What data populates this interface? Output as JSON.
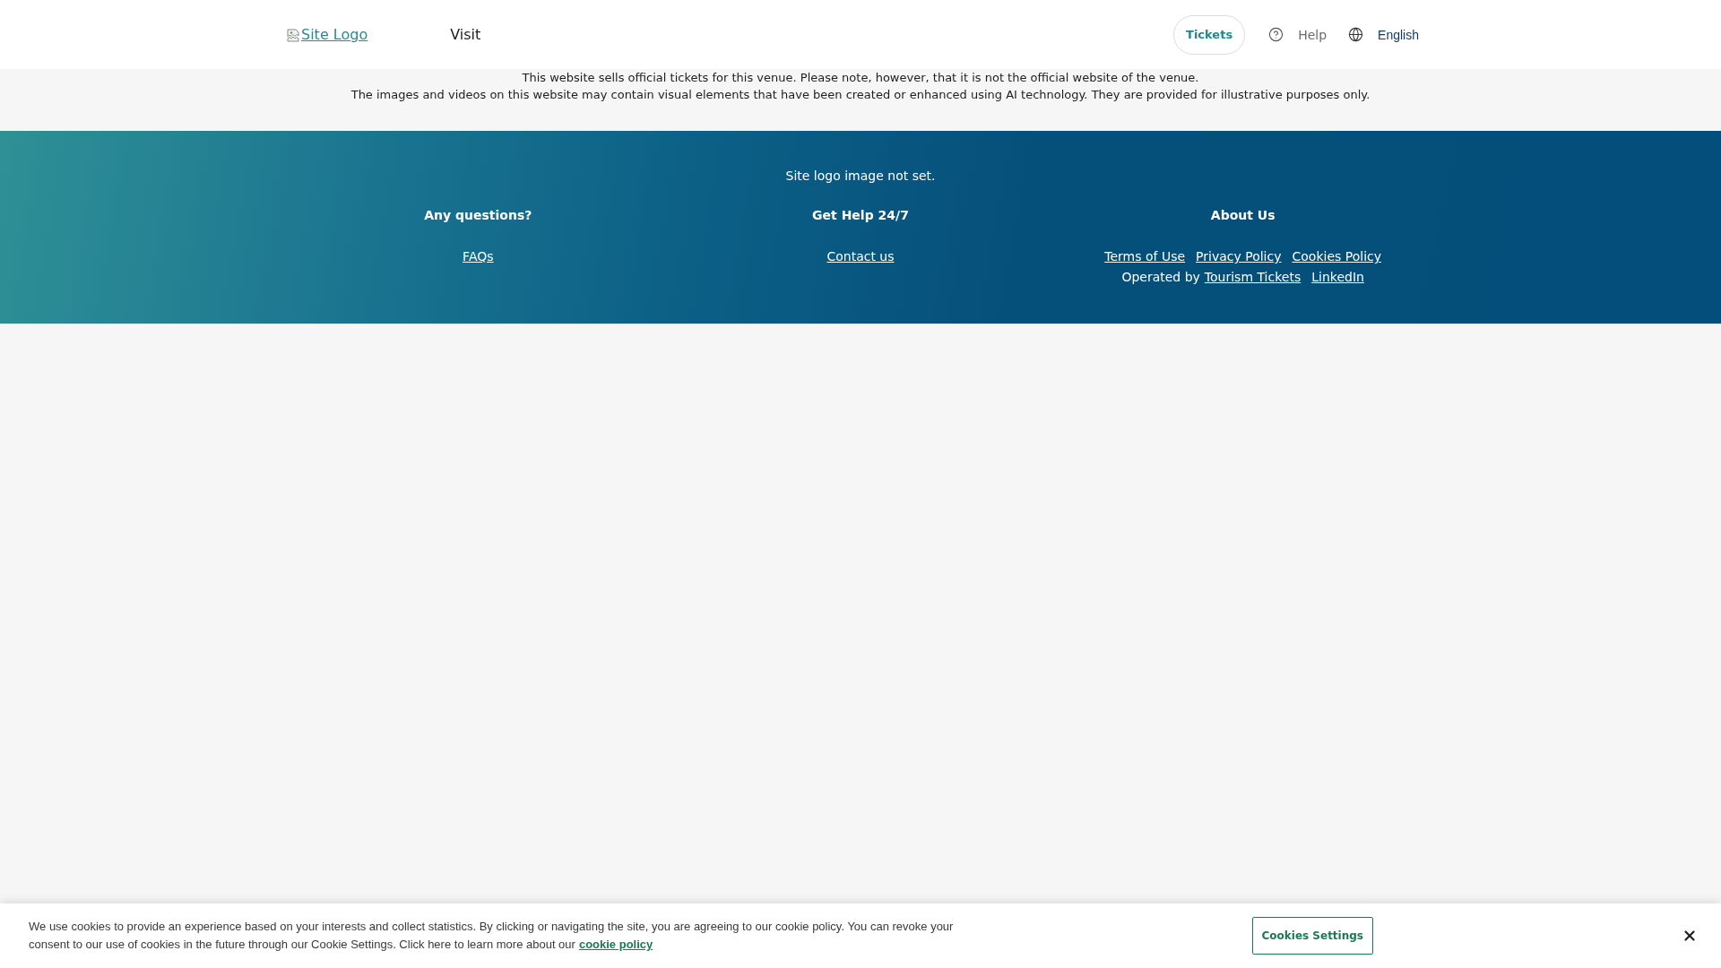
{
  "header": {
    "logo_link": "Site Logo",
    "nav": [
      {
        "label": "Visit"
      }
    ],
    "tickets_button": "Tickets",
    "help_link": "Help",
    "language_button": "English"
  },
  "notice": [
    "This website sells official tickets for this venue. Please note, however, that it is not the official website of the venue.",
    "The images and videos on this website may contain visual elements that have been created or enhanced using AI technology. They are provided for illustrative purposes only."
  ],
  "footer": {
    "logo_message": "Site logo image not set.",
    "columns": [
      {
        "heading": "Any questions?",
        "rows": [
          {
            "items": [
              {
                "kind": "link",
                "text": "FAQs"
              }
            ]
          }
        ]
      },
      {
        "heading": "Get Help 24/7",
        "rows": [
          {
            "items": [
              {
                "kind": "link",
                "text": "Contact us"
              }
            ]
          }
        ]
      },
      {
        "heading": "About Us",
        "rows": [
          {
            "items": [
              {
                "kind": "link",
                "text": "Terms of Use"
              },
              {
                "kind": "link",
                "text": "Privacy Policy"
              },
              {
                "kind": "link",
                "text": "Cookies Policy"
              }
            ]
          },
          {
            "items": [
              {
                "kind": "text",
                "text": "Operated by"
              },
              {
                "kind": "link",
                "text": "Tourism Tickets"
              },
              {
                "kind": "link",
                "text": "LinkedIn"
              }
            ]
          }
        ]
      }
    ]
  },
  "cookie_banner": {
    "text": "We use cookies to provide an experience based on your interests and collect statistics. By clicking or navigating the site, you are agreeing to our cookie policy. You can revoke your consent to our use of cookies in the future through our Cookie Settings. Click here to learn more about our",
    "policy_link": "cookie policy",
    "settings_button": "Cookies Settings"
  }
}
